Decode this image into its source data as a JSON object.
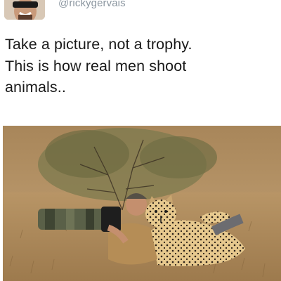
{
  "tweet": {
    "handle": "@rickygervais",
    "avatar_icon": "profile-avatar-man-with-sunglasses",
    "text_lines": [
      "Take a picture, not a trophy.",
      "This is how real men shoot",
      "animals.."
    ]
  },
  "photo": {
    "subject": "photo-man-with-camera-and-cheetah"
  },
  "colors": {
    "handle": "#8b96a0",
    "text": "#1a1a1a",
    "background": "#ffffff"
  }
}
